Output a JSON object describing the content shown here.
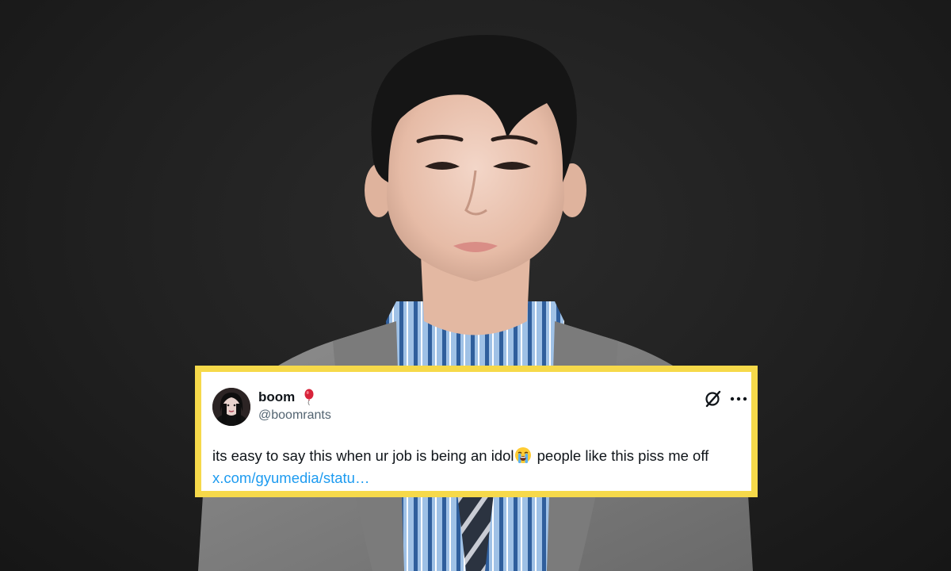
{
  "tweet": {
    "display_name": "boom",
    "handle": "@boomrants",
    "name_badge_icon": "red-balloon-emoji",
    "text_before_emoji": "its easy to say this when ur job is being an idol",
    "emoji_icon": "loudly-crying-face-emoji",
    "text_after_emoji": " people like this piss me off ",
    "link": "x.com/gyumedia/statu…"
  },
  "colors": {
    "frame": "#f6d94a",
    "card": "#ffffff",
    "text": "#0f1419",
    "handle": "#536471",
    "link": "#1d9bf0",
    "background": "#1f1f1f"
  }
}
